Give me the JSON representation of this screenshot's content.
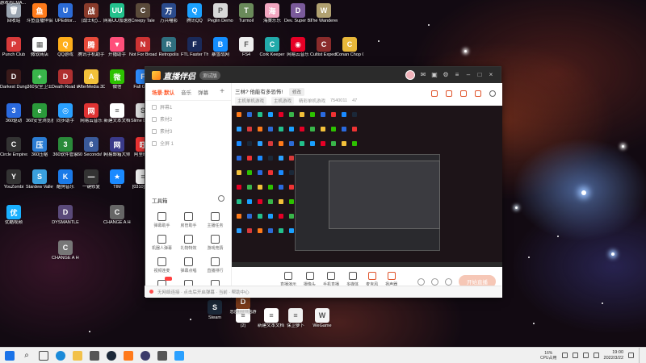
{
  "desktop_icons": [
    {
      "label": "回收站",
      "color": "#9aa4b0",
      "glyph": "🗑"
    },
    {
      "label": "斗鱼直播伴侣",
      "color": "#ff7a1a",
      "glyph": "鱼"
    },
    {
      "label": "UPEditor...",
      "color": "#2c6bd6",
      "glyph": "U"
    },
    {
      "label": "(战士纪)...",
      "color": "#8a3b2b",
      "glyph": "战"
    },
    {
      "label": "网易UU加速器",
      "color": "#23c08c",
      "glyph": "UU"
    },
    {
      "label": "Creepy Tale",
      "color": "#5a4a3a",
      "glyph": "C"
    },
    {
      "label": "万兴喵影",
      "color": "#2b4b8c",
      "glyph": "万"
    },
    {
      "label": "腾讯QQ",
      "color": "#1aa0ff",
      "glyph": "Q"
    },
    {
      "label": "Peglin Demo",
      "color": "#d8d8d8",
      "glyph": "P"
    },
    {
      "label": "Turmoil",
      "color": "#6a8a5a",
      "glyph": "T"
    },
    {
      "label": "海棠乐乐",
      "color": "#f2a6c0",
      "glyph": "海"
    },
    {
      "label": "Dev. Super Baksan",
      "color": "#7a5a9a",
      "glyph": "D"
    },
    {
      "label": "The Wanderer",
      "color": "#b0a070",
      "glyph": "W"
    },
    {
      "label": "Punch Club",
      "color": "#d83a3a",
      "glyph": "P"
    },
    {
      "label": "微软商店",
      "color": "#ffffff",
      "glyph": "▦"
    },
    {
      "label": "QQ游戏",
      "color": "#ffae1a",
      "glyph": "Q"
    },
    {
      "label": "腾讯手机助手",
      "color": "#e84a3a",
      "glyph": "腾"
    },
    {
      "label": "开播助手",
      "color": "#ff4f7a",
      "glyph": "▼"
    },
    {
      "label": "Not For Broadcast",
      "color": "#c33",
      "glyph": "N"
    },
    {
      "label": "Retropolis",
      "color": "#2f6f7f",
      "glyph": "R"
    },
    {
      "label": "FTL Faster Than Light",
      "color": "#1a2a5a",
      "glyph": "F"
    },
    {
      "label": "暴雪战网",
      "color": "#148eff",
      "glyph": "B"
    },
    {
      "label": "FS4",
      "color": "#eee",
      "glyph": "F"
    },
    {
      "label": "Cork Keeper",
      "color": "#2aa",
      "glyph": "C"
    },
    {
      "label": "网易云音乐",
      "color": "#e60026",
      "glyph": "◉"
    },
    {
      "label": "Cultist Expedition",
      "color": "#8a2b2b",
      "glyph": "C"
    },
    {
      "label": "Conan Chop Chop",
      "color": "#e8b83a",
      "glyph": "C"
    },
    {
      "label": "Darkest Dungeon",
      "color": "#3a1a1a",
      "glyph": "D"
    },
    {
      "label": "360安全卫士",
      "color": "#39b54a",
      "glyph": "+"
    },
    {
      "label": "Death Road to Canada",
      "color": "#b03030",
      "glyph": "D"
    },
    {
      "label": "AfterMedia 3D",
      "color": "#f3c13a",
      "glyph": "A"
    },
    {
      "label": "微信",
      "color": "#2dc100",
      "glyph": "微"
    },
    {
      "label": "Fall Guys",
      "color": "#2d8cff",
      "glyph": "F"
    },
    {
      "label": "360驱动",
      "color": "#2a6adf",
      "glyph": "3"
    },
    {
      "label": "360安全浏览器",
      "color": "#2a9a3a",
      "glyph": "e"
    },
    {
      "label": "同步助手",
      "color": "#2aa0ff",
      "glyph": "◎"
    },
    {
      "label": "网易云音乐",
      "color": "#e03333",
      "glyph": "网"
    },
    {
      "label": "新建文本文档",
      "color": "#ffffff",
      "glyph": "≡"
    },
    {
      "label": "Slime Demo",
      "color": "#ddd",
      "glyph": "S"
    },
    {
      "label": "Circle Empires",
      "color": "#333",
      "glyph": "C"
    },
    {
      "label": "360压缩",
      "color": "#2b7cd3",
      "glyph": "压"
    },
    {
      "label": "360软件管家",
      "color": "#2a8a3a",
      "glyph": "3"
    },
    {
      "label": "60 Seconds! Reatomized",
      "color": "#3a5a9a",
      "glyph": "6"
    },
    {
      "label": "网易邮箱大师",
      "color": "#3a3a8a",
      "glyph": "网"
    },
    {
      "label": "阿里旺旺",
      "color": "#e33",
      "glyph": "旺"
    },
    {
      "label": "YouZombi",
      "color": "#333",
      "glyph": "Y"
    },
    {
      "label": "Stardew Valley",
      "color": "#3aa0dd",
      "glyph": "S"
    },
    {
      "label": "酷狗音乐",
      "color": "#1a7ae8",
      "glyph": "K"
    },
    {
      "label": "一键修复",
      "color": "#333",
      "glyph": "一"
    },
    {
      "label": "TIM",
      "color": "#1a8aff",
      "glyph": "★"
    },
    {
      "label": "[0310]狂暴",
      "color": "#eee",
      "glyph": "≡"
    },
    {
      "label": "优酷视频",
      "color": "#1ab0ff",
      "glyph": "优"
    },
    {
      "label": "DYSMANTLE",
      "color": "#5a4a7a",
      "glyph": "D"
    },
    {
      "label": "CHANGE A Homeless",
      "color": "#666",
      "glyph": "C"
    },
    {
      "label": "CHANGE A Homeless...",
      "color": "#777",
      "glyph": "C"
    },
    {
      "label": "Steam",
      "color": "#1b2838",
      "glyph": "S"
    },
    {
      "label": "(2)",
      "color": "#ffffff",
      "glyph": "≡"
    },
    {
      "label": "新建文本文档 (3)",
      "color": "#ffffff",
      "glyph": "≡"
    },
    {
      "label": "保卫萝卜",
      "color": "#f0f0f0",
      "glyph": "≡"
    },
    {
      "label": "WeGame",
      "color": "#f5f5f5",
      "glyph": "W"
    },
    {
      "label": "恶魔城开始游",
      "color": "#7a3a1a",
      "glyph": "D"
    },
    {
      "label": "推荐性",
      "color": "#ddd",
      "glyph": ""
    },
    {
      "label": "全球玩家 0...",
      "color": "#ddd",
      "glyph": ""
    },
    {
      "label": "游戏与LMA...",
      "color": "#ddd",
      "glyph": ""
    }
  ],
  "app": {
    "name": "直播伴侣",
    "version_badge": "测试版",
    "left_tabs": [
      "场景·默认",
      "音乐",
      "弹幕",
      "+"
    ],
    "scenes": [
      "屏幕1",
      "素材2",
      "素材3",
      "全屏 1"
    ],
    "toolbox_title": "工具箱",
    "tools": [
      {
        "label": "弹幕助手"
      },
      {
        "label": "房管助手"
      },
      {
        "label": "主播任务"
      },
      {
        "label": "机器人弹幕"
      },
      {
        "label": "礼物特效"
      },
      {
        "label": "游戏竞猜"
      },
      {
        "label": "视频连麦"
      },
      {
        "label": "弹幕点唱"
      },
      {
        "label": "直播排行"
      },
      {
        "label": "更多"
      },
      {
        "label": "粉丝团"
      },
      {
        "label": "新游推荐"
      }
    ],
    "room_title": "三林? 他能有多恐怖!",
    "edit_label": "修改",
    "room_meta": [
      "主机单机游戏",
      "主机游戏",
      "精彩单机游戏",
      "7540011",
      "47"
    ],
    "bottom_tools": [
      "直播演示",
      "摄像头",
      "手机直播",
      "多媒体",
      "麦克风",
      "扬声器"
    ],
    "start_live": "开始直播",
    "status_text": "无网络连接 · 点击后开启弹幕 · 当前 · 帮助中心"
  },
  "taskbar": {
    "search_glyph": "⌕",
    "cpu_percent": "16%",
    "cpu_label": "CPU占用",
    "time": "19:00",
    "date": "2022/3/22"
  }
}
